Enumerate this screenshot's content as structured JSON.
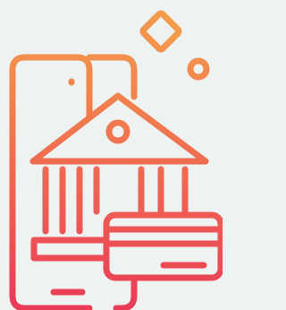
{
  "illustration": {
    "icon": "mobile-banking-icon",
    "background_color": "#eef2f1",
    "gradient_top_color": "#f5a24a",
    "gradient_bottom_color": "#ea3b57",
    "elements": [
      "smartphone",
      "bank-building",
      "credit-card",
      "diamond-shape",
      "circle-shape"
    ]
  }
}
